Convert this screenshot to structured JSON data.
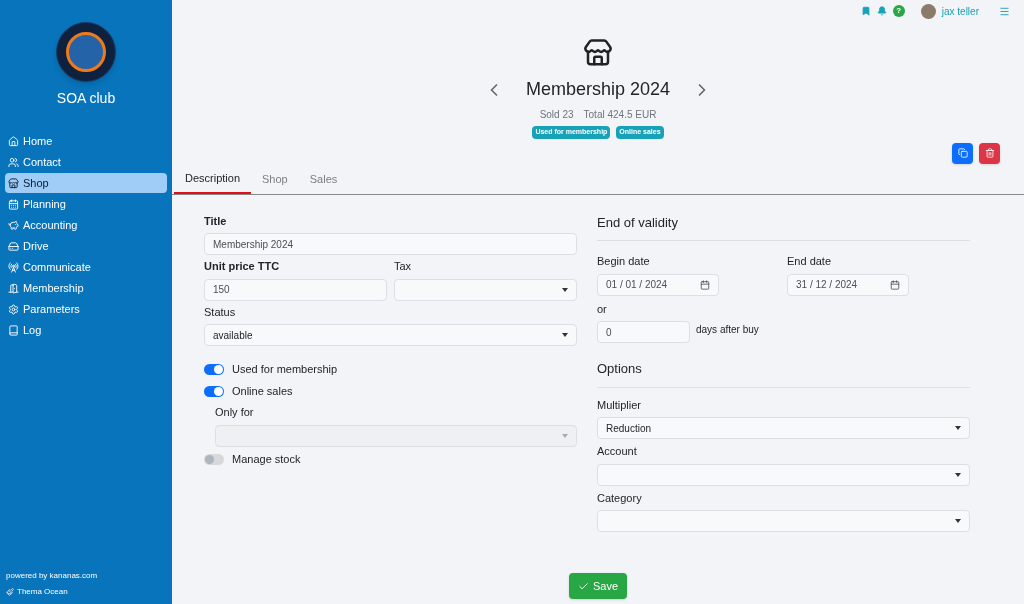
{
  "sidebar": {
    "club_name": "SOA club",
    "items": [
      {
        "label": "Home",
        "selected": false
      },
      {
        "label": "Contact",
        "selected": false
      },
      {
        "label": "Shop",
        "selected": true
      },
      {
        "label": "Planning",
        "selected": false
      },
      {
        "label": "Accounting",
        "selected": false
      },
      {
        "label": "Drive",
        "selected": false
      },
      {
        "label": "Communicate",
        "selected": false
      },
      {
        "label": "Membership",
        "selected": false
      },
      {
        "label": "Parameters",
        "selected": false
      },
      {
        "label": "Log",
        "selected": false
      }
    ],
    "footer": {
      "powered_by": "powered by kananas.com",
      "theme": "Thema Ocean"
    }
  },
  "top_bar": {
    "help": "?",
    "user": "jax teller"
  },
  "product": {
    "title": "Membership 2024",
    "sold": "Sold 23",
    "total": "Total 424.5 EUR",
    "badges": [
      "Used for membership",
      "Online sales"
    ]
  },
  "tabs": [
    {
      "label": "Description",
      "selected": true
    },
    {
      "label": "Shop",
      "selected": false
    },
    {
      "label": "Sales",
      "selected": false
    }
  ],
  "form": {
    "title": {
      "label": "Title",
      "value": "Membership 2024"
    },
    "unit_price": {
      "label": "Unit price TTC",
      "value": "150"
    },
    "tax": {
      "label": "Tax"
    },
    "status": {
      "label": "Status",
      "value": "available"
    },
    "switches": [
      {
        "label": "Used for membership",
        "on": true
      },
      {
        "label": "Online sales",
        "on": true
      }
    ],
    "only_for": {
      "label": "Only for",
      "disabled": true
    },
    "manage_stock": {
      "label": "Manage stock",
      "on": false
    },
    "end_of_validity": {
      "heading": "End of validity",
      "begin": {
        "label": "Begin date",
        "value": "01 / 01 / 2024"
      },
      "end": {
        "label": "End date",
        "value": "31 / 12 / 2024"
      },
      "or": "or",
      "days": "0",
      "days_suffix": "days after buy"
    },
    "options": {
      "heading": "Options",
      "selects": [
        {
          "label": "Multiplier",
          "value": "Reduction"
        },
        {
          "label": "Account"
        },
        {
          "label": "Category"
        }
      ]
    }
  },
  "save_button": "Save"
}
